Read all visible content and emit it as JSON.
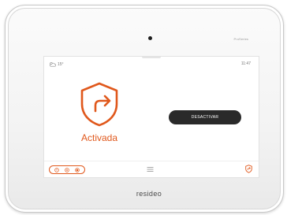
{
  "device": {
    "series_label": "ProSeries",
    "brand": "resideo"
  },
  "status_bar": {
    "weather_icon": "cloud-sun-icon",
    "temperature": "15°",
    "time": "11:47"
  },
  "security": {
    "state_icon": "shield-arrow-icon",
    "state_label": "Activada",
    "action_button_label": "DESACTIVAR"
  },
  "bottom_bar": {
    "mode_icons": [
      "mode-away-icon",
      "mode-stay-icon",
      "mode-night-icon"
    ],
    "menu_icon": "hamburger-menu-icon",
    "security_icon": "shield-icon"
  },
  "colors": {
    "accent": "#e0581c",
    "button_bg": "#2a2a2a"
  }
}
